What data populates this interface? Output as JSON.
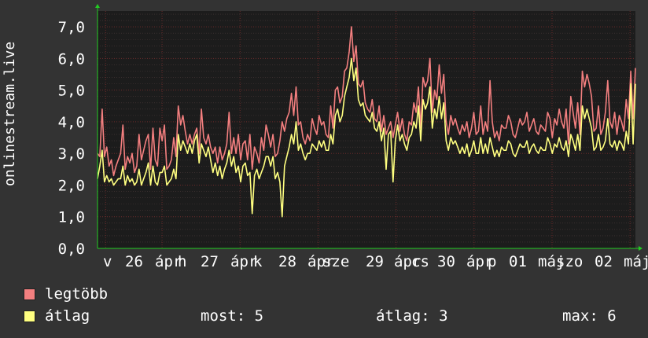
{
  "chart_data": {
    "type": "line",
    "ylabel": "onlinestream.live",
    "ylim": [
      0,
      7.5
    ],
    "yticks": [
      "0,0",
      "1,0",
      "2,0",
      "3,0",
      "4,0",
      "5,0",
      "6,0",
      "7,0"
    ],
    "xticks": [
      "v",
      "26",
      "ápr",
      "h",
      "27",
      "ápr",
      "k",
      "28",
      "ápr",
      "sze",
      "29",
      "ápr",
      "cs",
      "30",
      "ápr",
      "p",
      "01",
      "máj",
      "szo",
      "02",
      "máj"
    ],
    "grid": true,
    "series": [
      {
        "name": "legtöbb",
        "color": "#f37f7f",
        "values": [
          3.0,
          2.9,
          4.4,
          2.9,
          3.2,
          2.6,
          2.8,
          2.3,
          2.6,
          2.8,
          3.0,
          3.9,
          2.5,
          2.9,
          2.7,
          3.0,
          2.4,
          2.6,
          3.6,
          2.8,
          3.1,
          3.4,
          3.6,
          2.5,
          3.8,
          2.8,
          2.6,
          3.8,
          3.4,
          3.9,
          2.5,
          2.6,
          2.8,
          3.5,
          2.9,
          4.5,
          3.9,
          4.2,
          3.7,
          3.3,
          3.6,
          3.3,
          3.6,
          3.8,
          3.0,
          4.4,
          3.5,
          3.3,
          3.6,
          3.2,
          3.0,
          3.2,
          2.7,
          3.2,
          2.8,
          3.0,
          3.3,
          4.3,
          3.0,
          3.5,
          3.0,
          3.6,
          2.8,
          3.3,
          3.4,
          2.8,
          3.6,
          2.5,
          3.2,
          3.0,
          2.7,
          3.5,
          3.1,
          3.9,
          3.6,
          3.2,
          3.6,
          2.9,
          3.0,
          3.4,
          4.0,
          3.7,
          4.1,
          4.3,
          4.9,
          4.2,
          5.1,
          3.9,
          4.0,
          3.5,
          3.3,
          3.6,
          3.4,
          4.1,
          3.8,
          3.6,
          4.2,
          3.9,
          4.0,
          3.6,
          3.5,
          4.5,
          3.8,
          5.0,
          5.1,
          4.6,
          4.8,
          5.6,
          5.7,
          6.2,
          7.0,
          5.9,
          6.4,
          5.2,
          5.1,
          5.3,
          4.6,
          4.4,
          4.3,
          4.7,
          4.1,
          4.0,
          4.5,
          3.7,
          4.2,
          3.6,
          3.8,
          4.0,
          3.5,
          3.9,
          4.3,
          3.7,
          4.1,
          3.6,
          3.4,
          4.0,
          3.9,
          4.6,
          4.3,
          5.1,
          3.8,
          5.4,
          5.1,
          5.3,
          6.0,
          4.3,
          5.0,
          4.7,
          5.8,
          4.9,
          5.5,
          4.0,
          3.6,
          4.2,
          3.9,
          4.1,
          3.8,
          3.6,
          3.9,
          3.7,
          4.0,
          3.5,
          3.8,
          4.3,
          3.6,
          3.7,
          4.5,
          3.6,
          4.0,
          3.7,
          5.3,
          4.0,
          3.5,
          3.7,
          3.4,
          3.9,
          3.8,
          3.8,
          4.2,
          4.0,
          3.6,
          3.5,
          3.8,
          4.1,
          3.9,
          4.0,
          4.3,
          3.7,
          3.9,
          4.1,
          3.7,
          3.6,
          3.9,
          3.8,
          3.7,
          4.3,
          4.1,
          3.5,
          4.1,
          3.9,
          4.4,
          4.0,
          3.8,
          4.4,
          3.3,
          4.8,
          4.3,
          3.8,
          4.6,
          3.6,
          5.6,
          5.1,
          5.5,
          5.2,
          4.8,
          3.7,
          3.8,
          4.5,
          3.6,
          3.8,
          4.3,
          5.3,
          4.0,
          3.8,
          4.3,
          3.6,
          4.2,
          4.0,
          3.7,
          4.7,
          4.1,
          5.6,
          4.1,
          5.7
        ]
      },
      {
        "name": "átlag",
        "color": "#ffff80",
        "values": [
          2.2,
          2.6,
          3.1,
          2.1,
          2.3,
          2.1,
          2.2,
          2.0,
          2.1,
          2.2,
          2.2,
          2.6,
          2.0,
          2.3,
          2.1,
          2.2,
          2.0,
          2.1,
          2.5,
          2.0,
          2.2,
          2.4,
          2.7,
          2.0,
          2.6,
          2.1,
          2.0,
          2.4,
          2.4,
          2.6,
          2.0,
          2.1,
          2.2,
          2.5,
          2.2,
          3.6,
          3.1,
          3.4,
          3.2,
          3.0,
          3.3,
          3.0,
          3.4,
          3.6,
          2.7,
          3.3,
          3.1,
          2.9,
          3.2,
          2.8,
          2.4,
          2.7,
          2.3,
          2.6,
          2.2,
          2.5,
          2.7,
          3.1,
          2.6,
          2.9,
          2.4,
          2.6,
          2.1,
          2.6,
          2.7,
          2.3,
          2.4,
          1.1,
          2.3,
          2.5,
          2.2,
          2.4,
          2.6,
          2.9,
          2.9,
          2.6,
          2.9,
          2.2,
          2.4,
          2.1,
          1.0,
          2.6,
          2.9,
          3.2,
          3.6,
          3.3,
          4.0,
          3.1,
          3.3,
          3.0,
          2.8,
          3.0,
          3.0,
          3.3,
          3.2,
          3.1,
          3.4,
          3.2,
          3.4,
          3.1,
          3.1,
          3.6,
          3.3,
          4.2,
          4.4,
          4.0,
          4.2,
          4.8,
          5.1,
          5.4,
          6.0,
          5.3,
          5.7,
          4.7,
          4.5,
          4.6,
          4.2,
          4.1,
          4.0,
          4.3,
          3.8,
          3.7,
          4.0,
          3.4,
          3.8,
          2.5,
          3.6,
          3.7,
          2.1,
          3.4,
          3.9,
          3.4,
          3.6,
          3.3,
          3.1,
          3.5,
          3.6,
          4.0,
          3.8,
          4.5,
          3.4,
          4.7,
          4.4,
          4.6,
          5.1,
          3.8,
          4.4,
          4.1,
          4.8,
          4.1,
          4.6,
          3.4,
          3.1,
          3.5,
          3.3,
          3.4,
          3.2,
          3.0,
          3.2,
          3.0,
          3.3,
          2.9,
          3.1,
          3.4,
          3.0,
          3.0,
          3.5,
          3.0,
          3.3,
          3.0,
          3.5,
          3.2,
          2.9,
          3.1,
          2.9,
          3.2,
          3.1,
          3.1,
          3.4,
          3.3,
          3.0,
          2.9,
          3.1,
          3.3,
          3.2,
          3.2,
          3.4,
          3.0,
          3.2,
          3.3,
          3.1,
          3.0,
          3.2,
          3.1,
          3.1,
          3.5,
          3.3,
          3.0,
          3.3,
          3.2,
          3.5,
          3.2,
          3.1,
          3.4,
          2.9,
          3.6,
          3.4,
          3.1,
          3.6,
          3.1,
          4.5,
          4.1,
          4.4,
          4.1,
          3.8,
          3.1,
          3.2,
          3.6,
          3.1,
          3.2,
          3.4,
          4.1,
          3.3,
          3.2,
          3.4,
          3.1,
          3.4,
          3.3,
          3.1,
          3.7,
          3.3,
          5.2,
          3.3,
          5.2
        ]
      }
    ]
  },
  "legend": [
    {
      "label": "legtöbb",
      "color": "#f37f7f"
    },
    {
      "label": "átlag",
      "color": "#ffff80"
    }
  ],
  "stats": {
    "now": "most: 5",
    "avg": "átlag: 3",
    "max": "max: 6"
  },
  "colors": {
    "background": "#333333",
    "plot_background": "#1c1c1c",
    "grid_major": "#6a2a2a",
    "grid_minor": "#4a3a3a",
    "axis_arrow": "#22cc22"
  }
}
